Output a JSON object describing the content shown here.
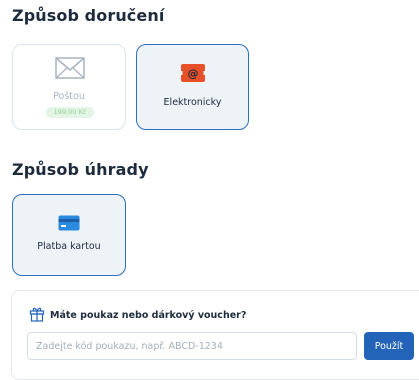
{
  "delivery": {
    "title": "Způsob doručení",
    "options": [
      {
        "label": "Poštou",
        "price": "199,00 Kč",
        "icon": "envelope-icon",
        "selected": false
      },
      {
        "label": "Elektronicky",
        "icon": "email-at-icon",
        "selected": true
      }
    ]
  },
  "payment": {
    "title": "Způsob úhrady",
    "options": [
      {
        "label": "Platba kartou",
        "icon": "credit-card-icon",
        "selected": true
      }
    ]
  },
  "voucher": {
    "title": "Máte poukaz nebo dárkový voucher?",
    "icon": "gift-icon",
    "input_placeholder": "Zadejte kód poukazu, např. ABCD-1234",
    "input_value": "",
    "apply_label": "Použít"
  },
  "colors": {
    "accent": "#2363b8",
    "selected_border": "#2d6fbf",
    "selected_bg": "#eef3f8",
    "email_icon": "#e8502a",
    "card_icon": "#2a8ae0",
    "price_badge_bg": "#e3f5e5"
  }
}
